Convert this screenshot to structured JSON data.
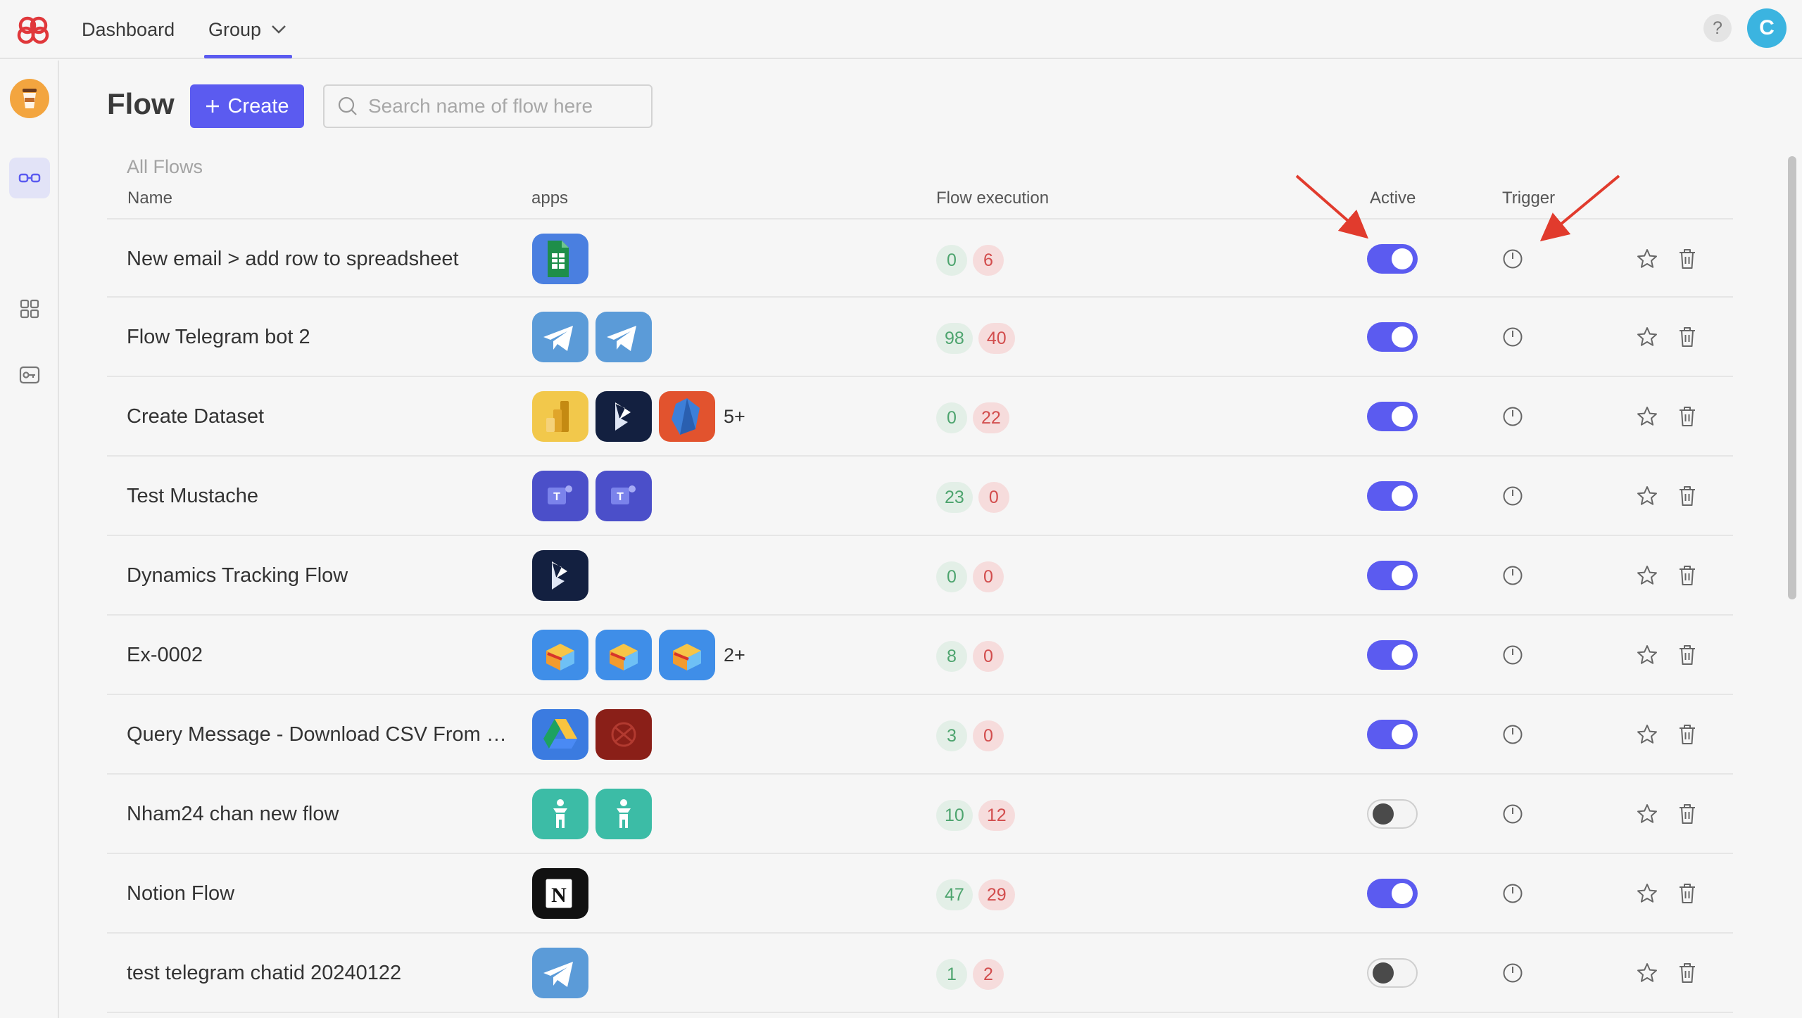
{
  "nav": {
    "dashboard_label": "Dashboard",
    "group_label": "Group",
    "help_label": "?",
    "user_initial": "C"
  },
  "page": {
    "title": "Flow",
    "create_label": "Create",
    "search_placeholder": "Search name of flow here",
    "section_label": "All Flows"
  },
  "columns": {
    "name": "Name",
    "apps": "apps",
    "execution": "Flow execution",
    "active": "Active",
    "trigger": "Trigger"
  },
  "colors": {
    "accent": "#5b5bf0",
    "success": "#4da46e",
    "error": "#d24d4d",
    "annotation_arrow": "#e13b2d"
  },
  "flows": [
    {
      "name": "New email > add row to spreadsheet",
      "apps": [
        "google-sheets-icon"
      ],
      "more": "",
      "success": "0",
      "failed": "6",
      "active": true
    },
    {
      "name": "Flow Telegram bot 2",
      "apps": [
        "telegram-icon",
        "telegram-icon"
      ],
      "more": "",
      "success": "98",
      "failed": "40",
      "active": true
    },
    {
      "name": "Create Dataset",
      "apps": [
        "power-bi-icon",
        "dynamics-icon",
        "crystal-app-icon"
      ],
      "more": "5+",
      "success": "0",
      "failed": "22",
      "active": true
    },
    {
      "name": "Test Mustache",
      "apps": [
        "teams-icon",
        "teams-icon"
      ],
      "more": "",
      "success": "23",
      "failed": "0",
      "active": true
    },
    {
      "name": "Dynamics Tracking Flow",
      "apps": [
        "dynamics-icon"
      ],
      "more": "",
      "success": "0",
      "failed": "0",
      "active": true
    },
    {
      "name": "Ex-0002",
      "apps": [
        "box-app-icon",
        "box-app-icon",
        "box-app-icon"
      ],
      "more": "2+",
      "success": "8",
      "failed": "0",
      "active": true
    },
    {
      "name": "Query Message - Download CSV From D...",
      "apps": [
        "google-drive-icon",
        "dark-red-app-icon"
      ],
      "more": "",
      "success": "3",
      "failed": "0",
      "active": true
    },
    {
      "name": "Nham24 chan new flow",
      "apps": [
        "nham24-icon",
        "nham24-icon"
      ],
      "more": "",
      "success": "10",
      "failed": "12",
      "active": false
    },
    {
      "name": "Notion Flow",
      "apps": [
        "notion-icon"
      ],
      "more": "",
      "success": "47",
      "failed": "29",
      "active": true
    },
    {
      "name": "test telegram chatid 20240122",
      "apps": [
        "telegram-icon"
      ],
      "more": "",
      "success": "1",
      "failed": "2",
      "active": false
    }
  ]
}
